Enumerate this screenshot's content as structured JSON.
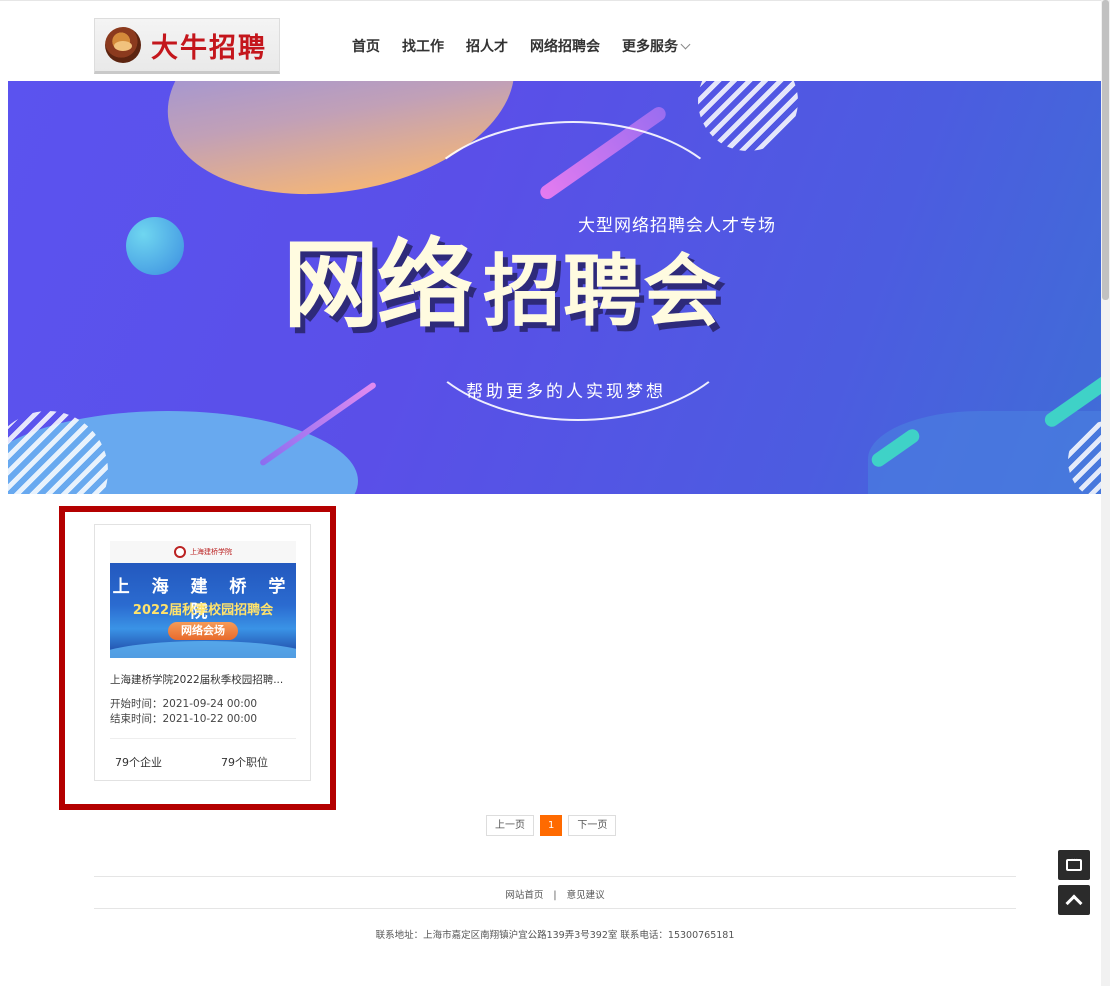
{
  "header": {
    "logo_text": "大牛招聘",
    "nav": [
      {
        "label": "首页"
      },
      {
        "label": "找工作"
      },
      {
        "label": "招人才"
      },
      {
        "label": "网络招聘会"
      },
      {
        "label": "更多服务"
      }
    ]
  },
  "banner": {
    "subtitle": "大型网络招聘会人才专场",
    "title_main": "网络",
    "title_second": "招聘会",
    "slogan": "帮助更多的人实现梦想"
  },
  "fair_card": {
    "poster": {
      "school_logo_text": "上海建桥学院",
      "line1": "上 海 建 桥 学 院",
      "line2": "2022届秋季校园招聘会",
      "tag": "网络会场"
    },
    "title": "上海建桥学院2022届秋季校园招聘...",
    "start_time": "开始时间：2021-09-24 00:00",
    "end_time": "结束时间：2021-10-22 00:00",
    "companies": "79个企业",
    "positions": "79个职位"
  },
  "pagination": {
    "prev": "上一页",
    "current": "1",
    "next": "下一页"
  },
  "footer": {
    "links": [
      "网站首页",
      "意见建议"
    ],
    "separator": "|",
    "address": "联系地址：上海市嘉定区南翔镇沪宜公路139弄3号392室   联系电话：15300765181"
  },
  "icons": {
    "chat": "chat-icon",
    "back_to_top": "arrow-up-icon"
  },
  "colors": {
    "highlight_border": "#b40000",
    "pager_active": "#ff6a00",
    "logo_red": "#c4161c"
  }
}
